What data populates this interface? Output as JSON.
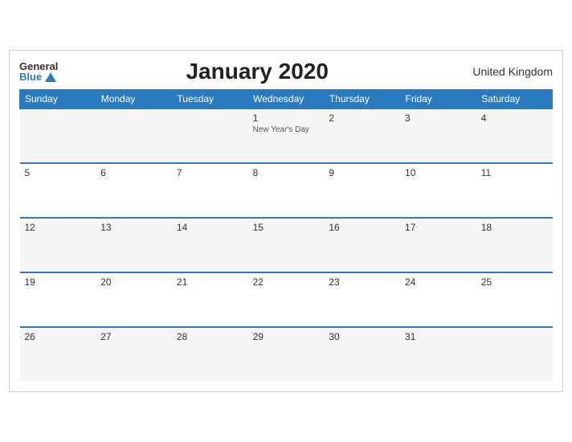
{
  "header": {
    "logo_general": "General",
    "logo_blue": "Blue",
    "title": "January 2020",
    "region": "United Kingdom"
  },
  "weekdays": [
    "Sunday",
    "Monday",
    "Tuesday",
    "Wednesday",
    "Thursday",
    "Friday",
    "Saturday"
  ],
  "weeks": [
    [
      {
        "day": "",
        "empty": true
      },
      {
        "day": "",
        "empty": true
      },
      {
        "day": "",
        "empty": true
      },
      {
        "day": "1",
        "event": "New Year's Day"
      },
      {
        "day": "2"
      },
      {
        "day": "3"
      },
      {
        "day": "4"
      }
    ],
    [
      {
        "day": "5"
      },
      {
        "day": "6"
      },
      {
        "day": "7"
      },
      {
        "day": "8"
      },
      {
        "day": "9"
      },
      {
        "day": "10"
      },
      {
        "day": "11"
      }
    ],
    [
      {
        "day": "12"
      },
      {
        "day": "13"
      },
      {
        "day": "14"
      },
      {
        "day": "15"
      },
      {
        "day": "16"
      },
      {
        "day": "17"
      },
      {
        "day": "18"
      }
    ],
    [
      {
        "day": "19"
      },
      {
        "day": "20"
      },
      {
        "day": "21"
      },
      {
        "day": "22"
      },
      {
        "day": "23"
      },
      {
        "day": "24"
      },
      {
        "day": "25"
      }
    ],
    [
      {
        "day": "26"
      },
      {
        "day": "27"
      },
      {
        "day": "28"
      },
      {
        "day": "29"
      },
      {
        "day": "30"
      },
      {
        "day": "31"
      },
      {
        "day": "",
        "empty": true
      }
    ]
  ]
}
